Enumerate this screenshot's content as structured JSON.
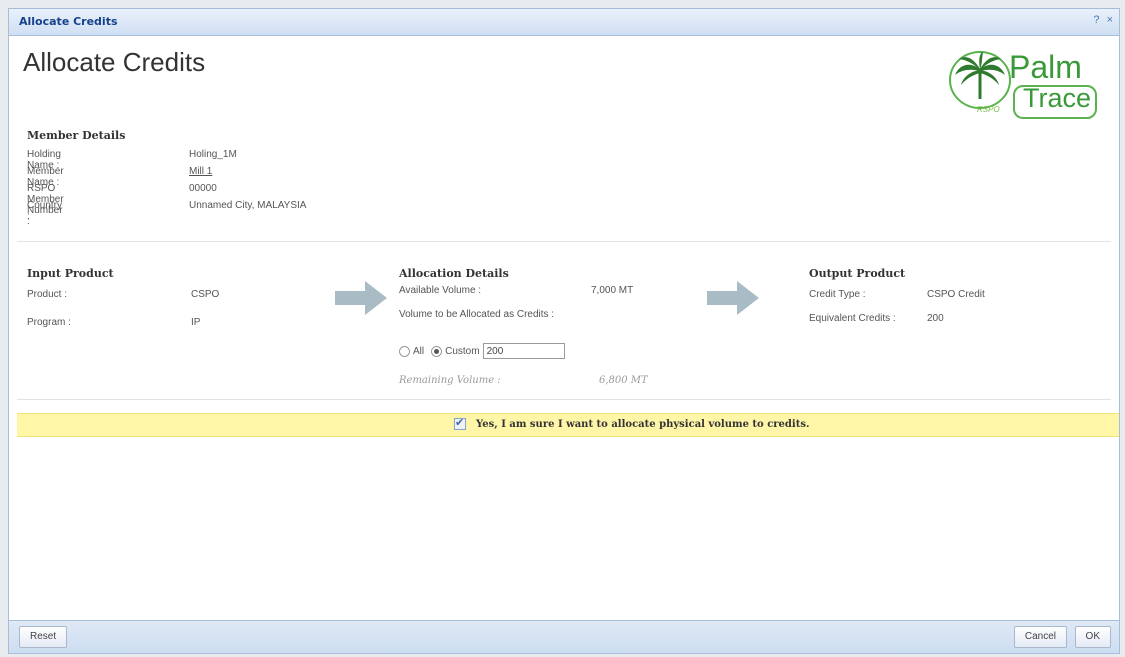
{
  "window": {
    "title": "Allocate Credits",
    "tools": [
      "?",
      "×"
    ]
  },
  "page_title": "Allocate Credits",
  "logo": {
    "palm": "Palm",
    "trace": "Trace",
    "rspo": "RSPO"
  },
  "member": {
    "heading": "Member Details",
    "rows": [
      {
        "label": "Holding Name :",
        "value": "Holing_1M"
      },
      {
        "label": "Member Name :",
        "value": "Mill 1"
      },
      {
        "label": "RSPO Member Number :",
        "value": "00000"
      },
      {
        "label": "Country :",
        "value": "Unnamed City, MALAYSIA"
      }
    ]
  },
  "input_product": {
    "heading": "Input Product",
    "product_label": "Product :",
    "product_value": "CSPO",
    "program_label": "Program :",
    "program_value": "IP"
  },
  "allocation": {
    "heading": "Allocation Details",
    "available_label": "Available Volume :",
    "available_value": "7,000 MT",
    "volume_label": "Volume to be Allocated as Credits :",
    "option_all": "All",
    "option_custom": "Custom",
    "custom_value": "200",
    "remaining_label": "Remaining Volume :",
    "remaining_value": "6,800 MT"
  },
  "output_product": {
    "heading": "Output Product",
    "credit_type_label": "Credit Type :",
    "credit_type_value": "CSPO Credit",
    "equivalent_label": "Equivalent Credits :",
    "equivalent_value": "200"
  },
  "confirm": {
    "text": "Yes, I am sure I want to allocate physical volume to credits.",
    "checked": true
  },
  "footer": {
    "reset": "Reset",
    "cancel": "Cancel",
    "ok": "OK"
  },
  "colors": {
    "arrow": "#a9bcc6",
    "confirm_bar": "#fff6a8",
    "logo_green": "#3a9a3a"
  },
  "icons": {
    "arrow": "arrow-right-icon",
    "palm_tree": "palm-tree-icon"
  }
}
